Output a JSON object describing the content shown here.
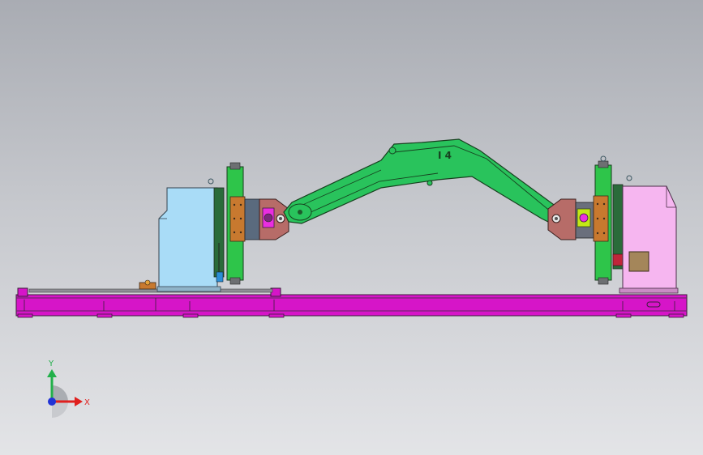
{
  "axes": {
    "x_label": "X",
    "y_label": "Y",
    "x_color": "#e0201e",
    "y_color": "#22b04a",
    "z_color": "#2133d6"
  },
  "model": {
    "boom_marking": "I 4"
  },
  "colors": {
    "base_rail": "#d615c8",
    "left_housing": "#a9dcf7",
    "right_housing": "#f6b6f0",
    "faceplate": "#2ec54a",
    "arm": "#29c35c",
    "clamp": "#b76c68",
    "pad": "#c8792f",
    "accent": "#c2e817"
  }
}
